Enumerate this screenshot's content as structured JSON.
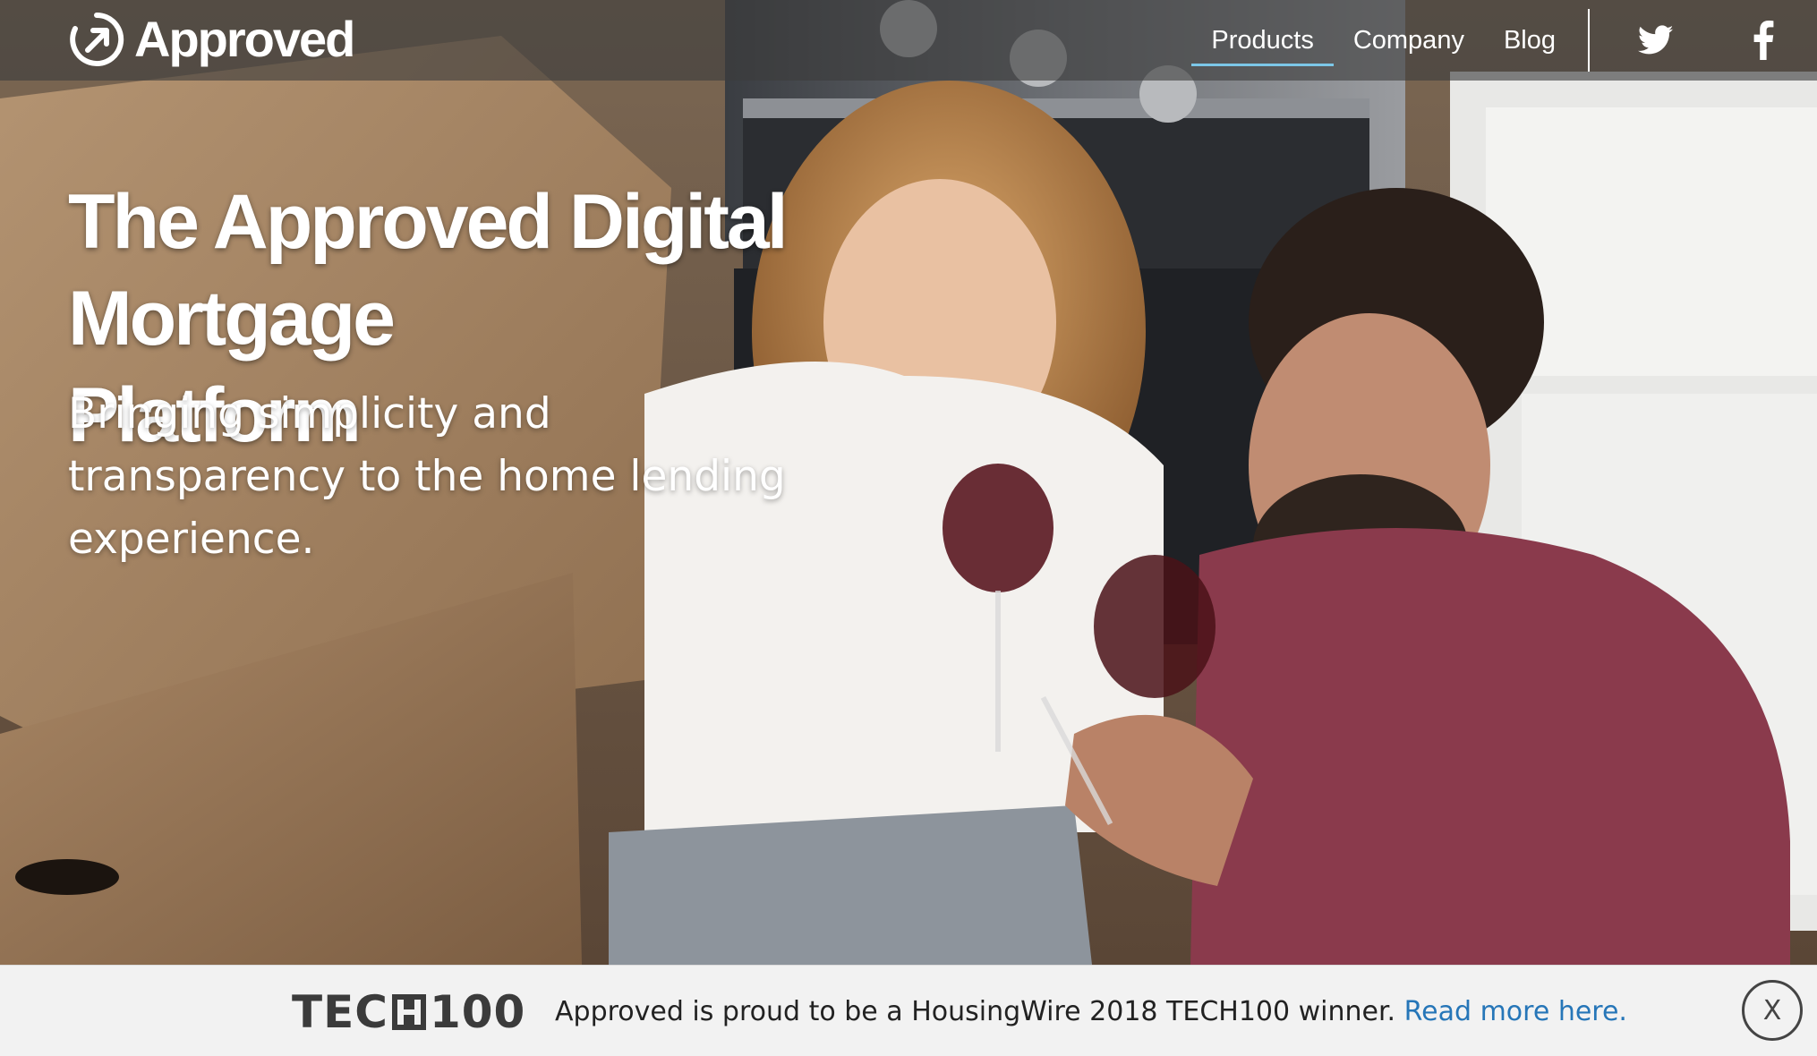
{
  "brand": {
    "name": "Approved",
    "logo_icon": "approved-circle-arrow-icon"
  },
  "nav": {
    "items": [
      {
        "label": "Products",
        "active": true
      },
      {
        "label": "Company",
        "active": false
      },
      {
        "label": "Blog",
        "active": false
      }
    ],
    "social": [
      {
        "icon": "twitter-icon"
      },
      {
        "icon": "facebook-icon"
      }
    ],
    "active_underline_color": "#7cc7e8"
  },
  "hero": {
    "headline_line1": "The Approved Digital Mortgage",
    "headline_line2": "Platform",
    "subhead_line1": "Bringing simplicity and",
    "subhead_line2": "transparency to the home lending",
    "subhead_line3": "experience.",
    "image_description_icon": "couple-toasting-wine-photo"
  },
  "banner": {
    "badge_text_left": "TEC",
    "badge_text_right": "100",
    "message": "Approved is proud to be a HousingWire 2018 TECH100 winner.",
    "link_text": "Read more here.",
    "close_label": "X",
    "link_color": "#2676b8"
  }
}
